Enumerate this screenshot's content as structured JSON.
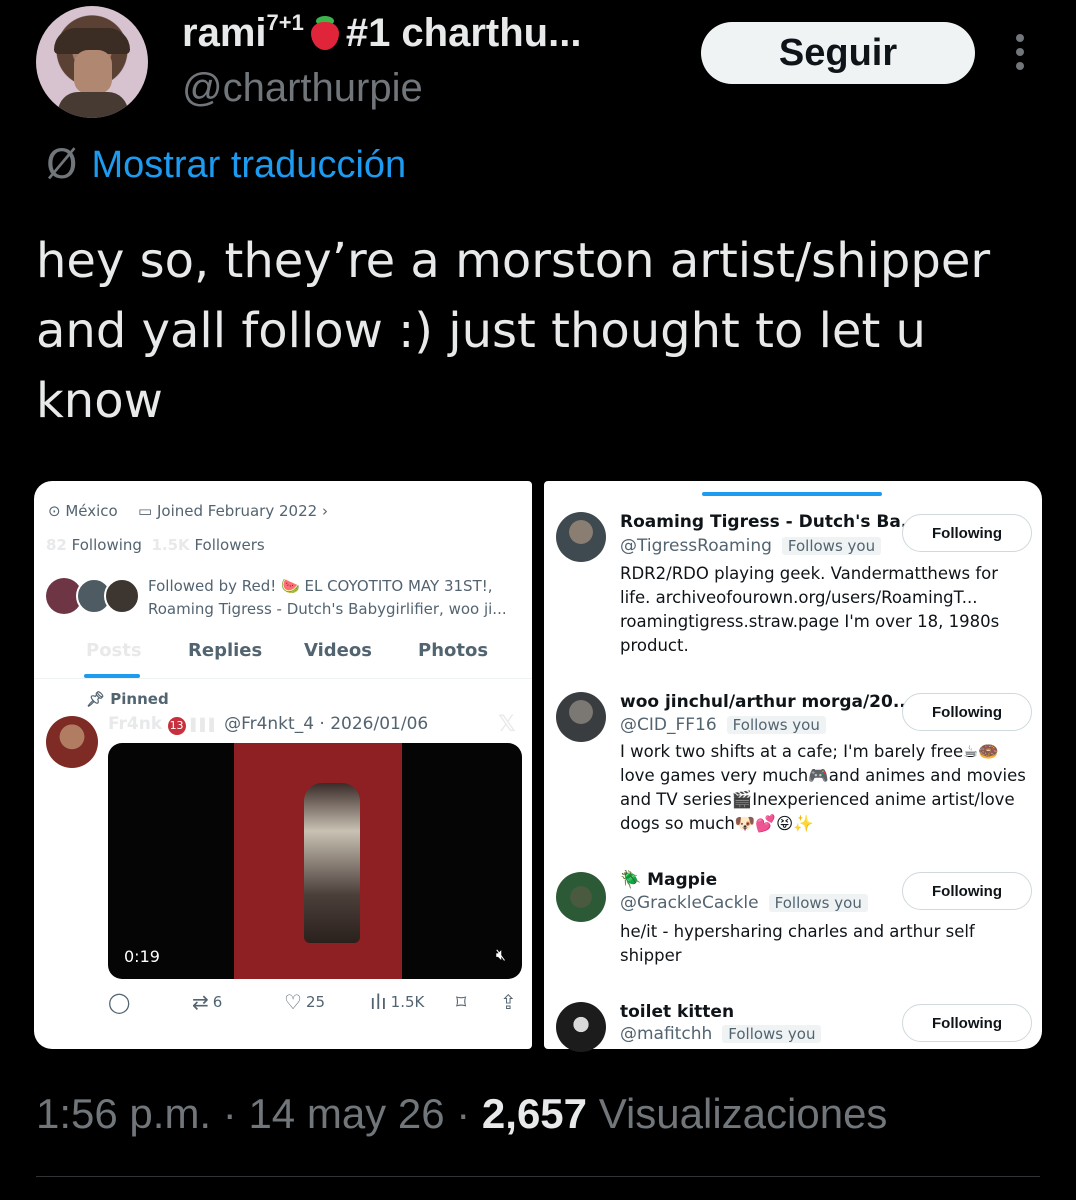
{
  "tweet": {
    "author_name": "rami",
    "author_sup": "7+1",
    "author_suffix": "#1 charthu...",
    "handle": "@charthurpie",
    "follow_label": "Seguir",
    "translate_label": "Mostrar traducción",
    "text": "hey so, they’re a morston artist/shipper and yall follow :) just thought to let u know",
    "time": "1:56 p.m.",
    "separator": "·",
    "date": "14 may 26",
    "views_count": "2,657",
    "views_label": "Visualizaciones"
  },
  "left_shot": {
    "location": "México",
    "joined": "Joined February 2022",
    "following_count": "82",
    "following_label": "Following",
    "followers_count": "1.5K",
    "followers_label": "Followers",
    "followed_by_line1": "Followed by Red! 🍉 EL COYOTITO MAY 31ST!,",
    "followed_by_line2": "Roaming Tigress - Dutch's Babygirlifier, woo ji...",
    "tabs": [
      "Posts",
      "Replies",
      "Videos",
      "Photos"
    ],
    "pinned_label": "Pinned",
    "post_author": "Fr4nk",
    "post_badge": "13",
    "post_handle_date": "@Fr4nkt_4 · 2026/01/06",
    "video_time": "0:19",
    "reposts": "6",
    "likes": "25",
    "views": "1.5K"
  },
  "right_shot": {
    "accounts": [
      {
        "name": "Roaming Tigress - Dutch's Ba...",
        "handle": "@TigressRoaming",
        "follows_you": "Follows you",
        "button": "Following",
        "bio": "RDR2/RDO playing geek. Vandermatthews for life. archiveofourown.org/users/RoamingT... roamingtigress.straw.page I'm over 18, 1980s product."
      },
      {
        "name": "woo jinchul/arthur morga/20...",
        "handle": "@CID_FF16",
        "follows_you": "Follows you",
        "button": "Following",
        "bio": "I work two shifts at a cafe; I'm barely free☕🍩 love games very much🎮and animes and movies and TV series🎬Inexperienced anime artist/love dogs so much🐶💕😝✨"
      },
      {
        "name": "🪲 Magpie",
        "handle": "@GrackleCackle",
        "follows_you": "Follows you",
        "button": "Following",
        "bio": "he/it - hypersharing charles and arthur self shipper"
      },
      {
        "name": "toilet kitten",
        "handle": "@mafitchh",
        "follows_you": "Follows you",
        "button": "Following",
        "bio": ""
      }
    ]
  },
  "colors": {
    "background": "#000000",
    "accent": "#1d9bf0",
    "text_primary": "#e7e9ea",
    "text_secondary": "#71767b"
  }
}
